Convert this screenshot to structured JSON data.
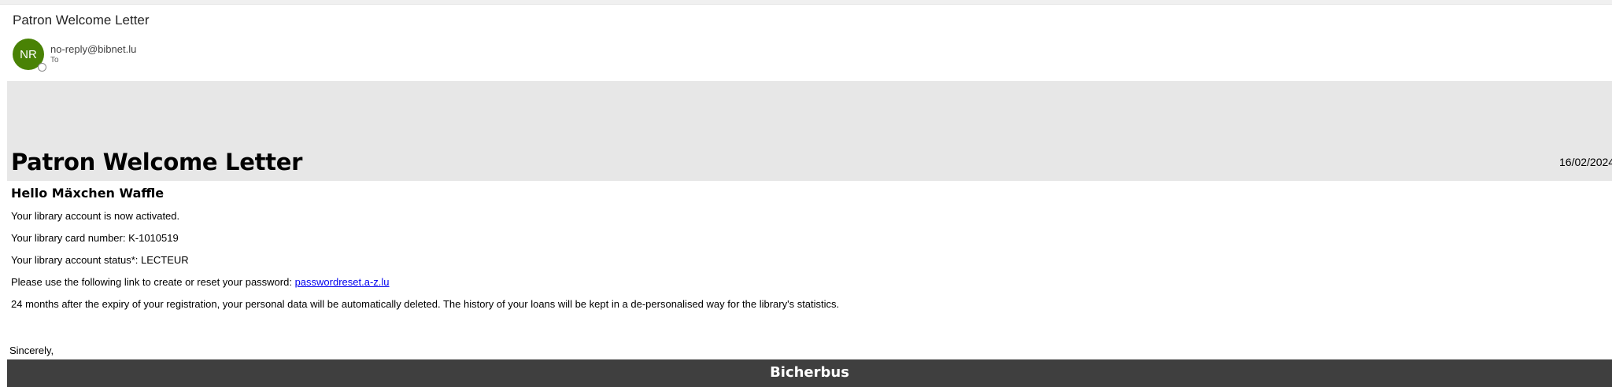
{
  "email": {
    "subject": "Patron Welcome Letter",
    "sender": {
      "initials": "NR",
      "address": "no-reply@bibnet.lu",
      "to_label": "To",
      "avatar_color": "#498205"
    }
  },
  "letter": {
    "title": "Patron Welcome Letter",
    "date": "16/02/2024",
    "greeting": "Hello Mäxchen Waffle",
    "line_activated": "Your library account is now activated.",
    "line_card": "Your library card number: K-1010519",
    "line_status": "Your library account status*: LECTEUR",
    "line_password_prefix": "Please use the following link to create or reset your password: ",
    "password_link": "passwordreset.a-z.lu",
    "line_retention": "24 months after the expiry of your registration, your personal data will be automatically deleted. The history of your loans will be kept in a de-personalised way for the library's statistics.",
    "closing": "Sincerely,",
    "footer": "Bicherbus"
  },
  "colors": {
    "banner": "#e7e7e7",
    "footer": "#3f3f3f",
    "link": "#0000ee"
  }
}
